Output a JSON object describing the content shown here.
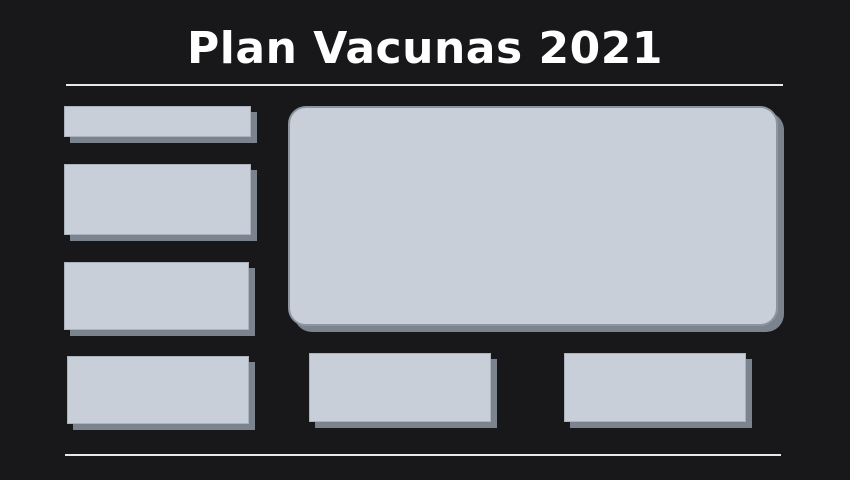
{
  "header": {
    "title": "Plan Vacunas 2021"
  },
  "colors": {
    "background": "#18181b",
    "card_fill": "#c8cfd9",
    "card_shadow": "#7b848e",
    "rule": "#e6e8ec",
    "title": "#ffffff"
  }
}
